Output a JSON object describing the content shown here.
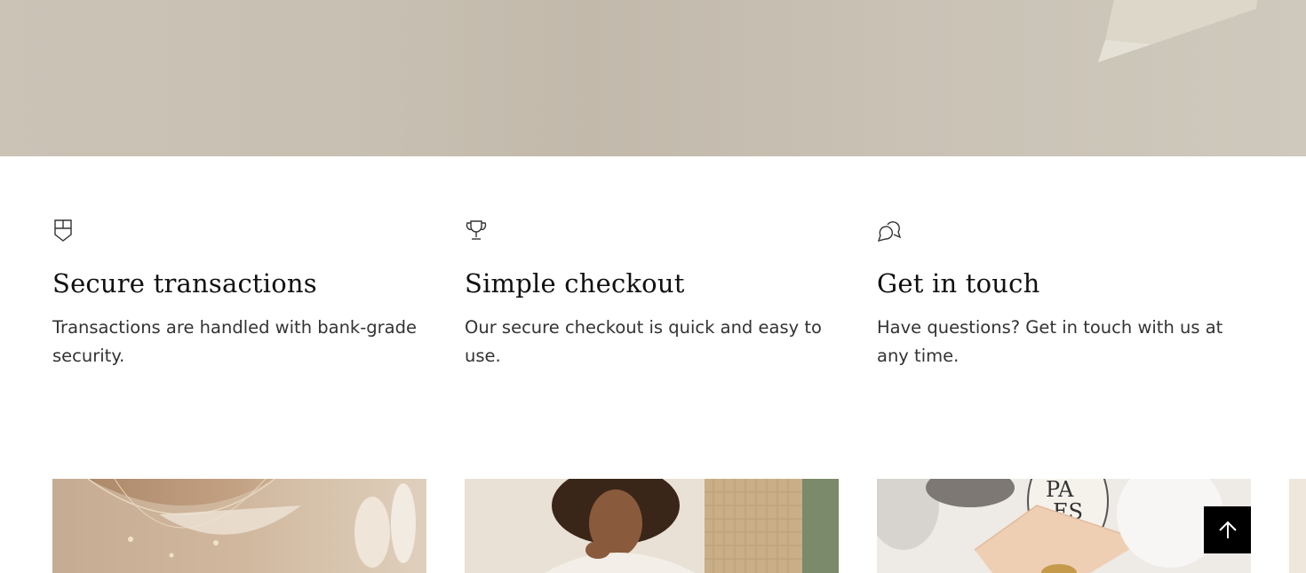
{
  "features": [
    {
      "icon": "shield-icon",
      "title": "Secure transactions",
      "text": "Transactions are handled with bank-grade security."
    },
    {
      "icon": "trophy-icon",
      "title": "Simple checkout",
      "text": "Our secure checkout is quick and easy to use."
    },
    {
      "icon": "chat-icon",
      "title": "Get in touch",
      "text": "Have questions? Get in touch with us at any time."
    }
  ],
  "products": [
    {
      "image": "necklace-photo"
    },
    {
      "image": "model-photo"
    },
    {
      "image": "perfume-photo",
      "label": "PA\nES"
    }
  ],
  "back_to_top": {
    "icon": "arrow-up-icon"
  },
  "colors": {
    "hero": "#c7bfb1",
    "text": "#333333",
    "heading": "#111111",
    "button": "#000000"
  }
}
